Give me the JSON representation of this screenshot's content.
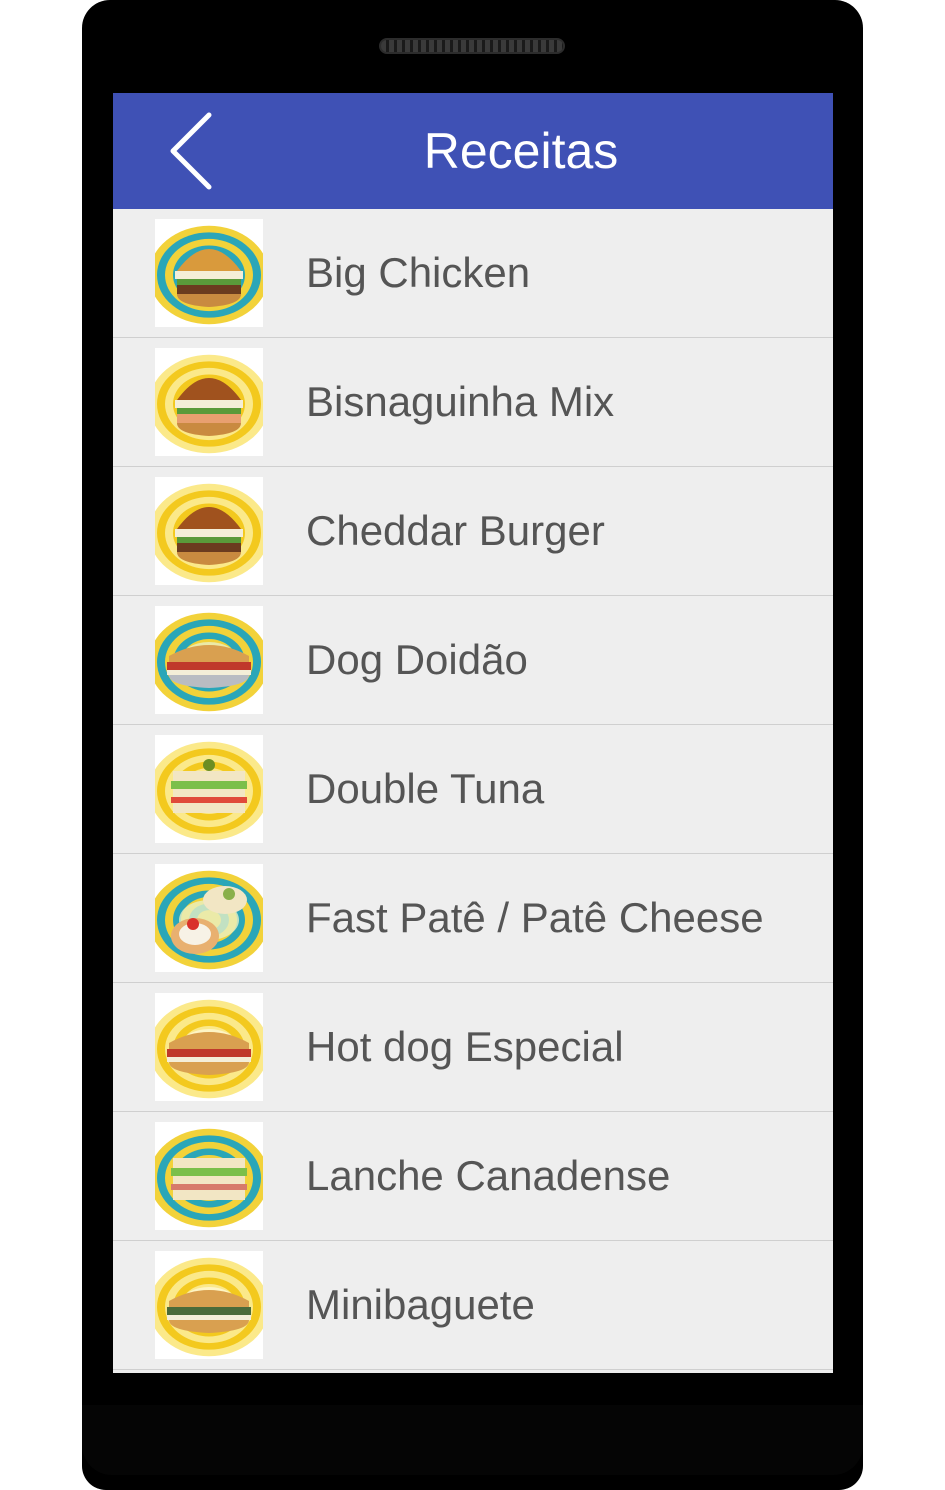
{
  "appbar": {
    "title": "Receitas",
    "back_icon": "chevron-left-icon",
    "background_color": "#3f51b5"
  },
  "recipes": [
    {
      "name": "Big Chicken",
      "thumb": "burger",
      "bg": "teal"
    },
    {
      "name": "Bisnaguinha Mix",
      "thumb": "bun-roll",
      "bg": "yellow"
    },
    {
      "name": "Cheddar Burger",
      "thumb": "burger",
      "bg": "yellow"
    },
    {
      "name": "Dog Doidão",
      "thumb": "hotdog-foil",
      "bg": "teal"
    },
    {
      "name": "Double Tuna",
      "thumb": "club-sandwich",
      "bg": "yellow"
    },
    {
      "name": "Fast Patê / Patê Cheese",
      "thumb": "toasts",
      "bg": "teal"
    },
    {
      "name": "Hot dog Especial",
      "thumb": "hotdog",
      "bg": "yellow"
    },
    {
      "name": "Lanche Canadense",
      "thumb": "sandwich",
      "bg": "teal"
    },
    {
      "name": "Minibaguete",
      "thumb": "baguette",
      "bg": "yellow"
    }
  ]
}
